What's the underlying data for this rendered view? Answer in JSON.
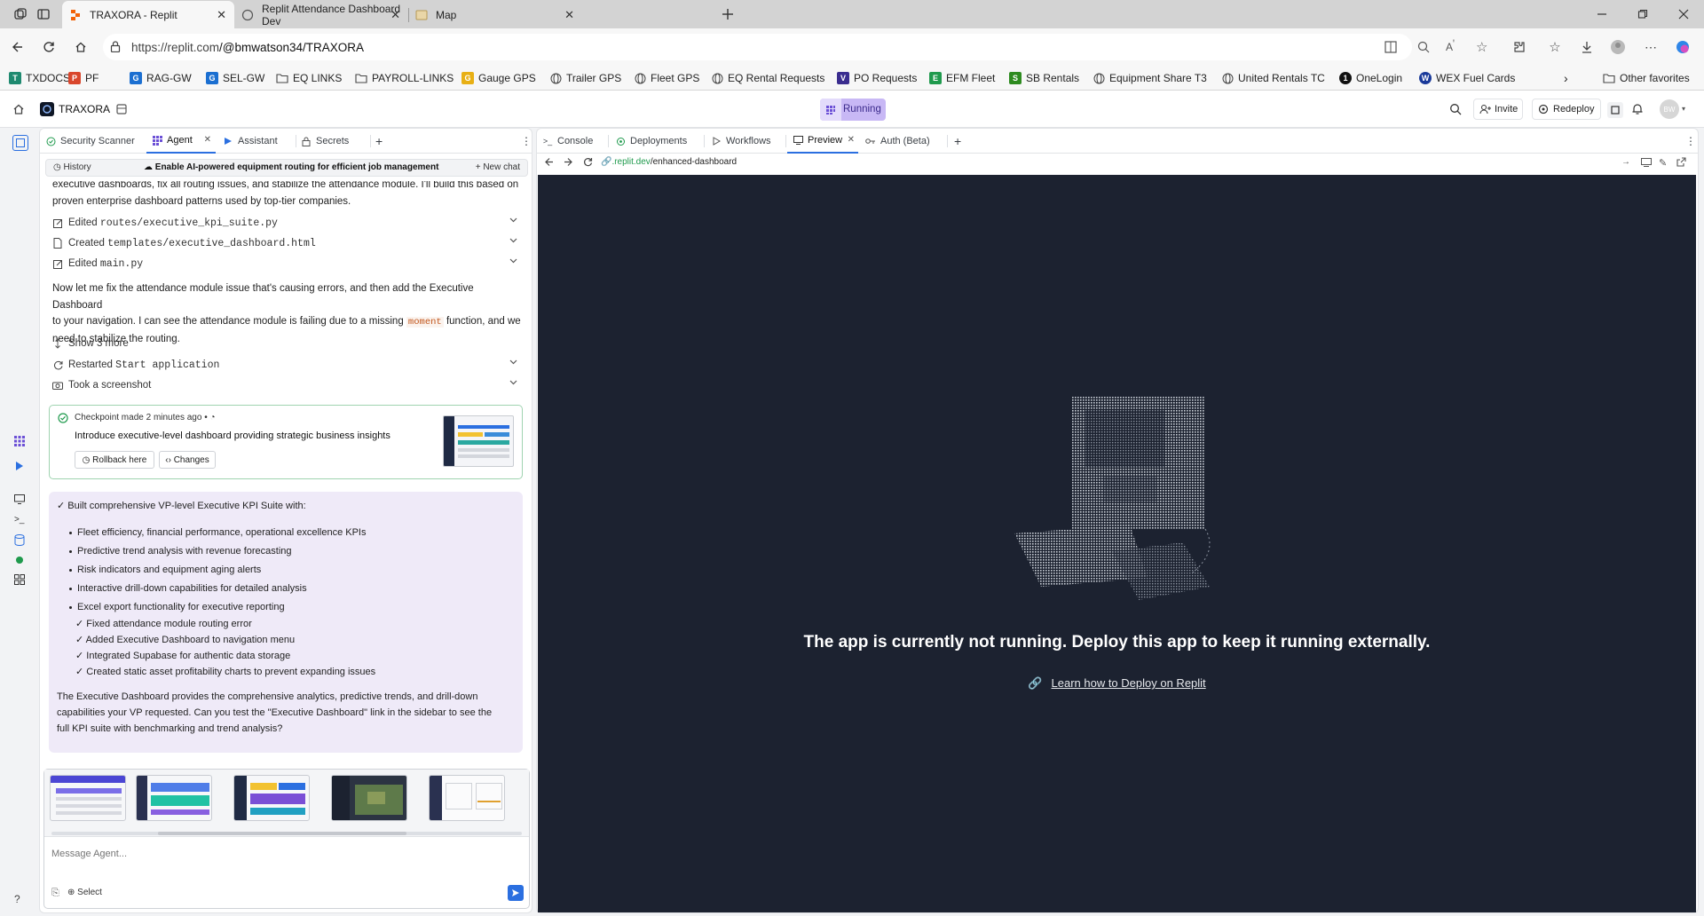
{
  "browser": {
    "tabs": [
      {
        "title": "TRAXORA - Replit"
      },
      {
        "title": "Replit Attendance Dashboard Dev"
      },
      {
        "title": "Map"
      }
    ],
    "address": {
      "prefix": "https://replit.com",
      "path": "/@bmwatson34/TRAXORA"
    },
    "favorites": [
      {
        "label": "TXDOCS",
        "color": "#1f8a70"
      },
      {
        "label": "PF",
        "color": "#d9462c"
      },
      {
        "label": "RAG-GW",
        "color": "#1b6fd1"
      },
      {
        "label": "SEL-GW",
        "color": "#1b6fd1"
      },
      {
        "label": "EQ LINKS",
        "icon": "folder"
      },
      {
        "label": "PAYROLL-LINKS",
        "icon": "folder"
      },
      {
        "label": "Gauge GPS",
        "color": "#e8b015"
      },
      {
        "label": "Trailer GPS",
        "icon": "globe"
      },
      {
        "label": "Fleet GPS",
        "icon": "globe"
      },
      {
        "label": "EQ Rental Requests",
        "icon": "globe"
      },
      {
        "label": "PO Requests",
        "color": "#3a2d8f"
      },
      {
        "label": "EFM Fleet",
        "color": "#1f9a4d"
      },
      {
        "label": "SB Rentals",
        "color": "#2e8b1f"
      },
      {
        "label": "Equipment Share T3",
        "icon": "globe"
      },
      {
        "label": "United Rentals TC",
        "icon": "globe"
      },
      {
        "label": "OneLogin",
        "color": "#111111"
      },
      {
        "label": "WEX Fuel Cards",
        "color": "#1a3a9a"
      }
    ],
    "other_favorites": "Other favorites"
  },
  "replit": {
    "project": "TRAXORA",
    "status": "Running",
    "invite": "Invite",
    "redeploy": "Redeploy",
    "avatar": "BW",
    "left_tabs": [
      "Security Scanner",
      "Agent",
      "Assistant",
      "Secrets"
    ],
    "right_tabs": [
      "Console",
      "Deployments",
      "Workflows",
      "Preview",
      "Auth (Beta)"
    ]
  },
  "agent": {
    "history": "History",
    "chat_title": "Enable AI-powered equipment routing for efficient job management",
    "new_chat": "New chat",
    "intro_line1": "executive dashboards, fix all routing issues, and stabilize the attendance module. I'll build this based on",
    "intro_line2": "proven enterprise dashboard patterns used by top-tier companies.",
    "actions": [
      {
        "verb": "Edited",
        "target": "routes/executive_kpi_suite.py"
      },
      {
        "verb": "Created",
        "target": "templates/executive_dashboard.html"
      },
      {
        "verb": "Edited",
        "target": "main.py"
      }
    ],
    "msg_line1": "Now let me fix the attendance module issue that's causing errors, and then add the Executive Dashboard",
    "msg_line2a": "to your navigation. I can see the attendance module is failing due to a missing",
    "msg_code": "moment",
    "msg_line2b": "function, and we",
    "msg_line3": "need to stabilize the routing.",
    "show_more": "Show 3 more",
    "restarted_verb": "Restarted",
    "restarted_target": "Start application",
    "screenshot": "Took a screenshot",
    "checkpoint": {
      "meta": "Checkpoint made 2 minutes ago",
      "title": "Introduce executive-level dashboard providing strategic business insights",
      "rollback": "Rollback here",
      "changes": "Changes"
    },
    "summary": {
      "heading": "✓ Built comprehensive VP-level Executive KPI Suite with:",
      "bullets": [
        "Fleet efficiency, financial performance, operational excellence KPIs",
        "Predictive trend analysis with revenue forecasting",
        "Risk indicators and equipment aging alerts",
        "Interactive drill-down capabilities for detailed analysis",
        "Excel export functionality for executive reporting"
      ],
      "checks": [
        "✓ Fixed attendance module routing error",
        "✓ Added Executive Dashboard to navigation menu",
        "✓ Integrated Supabase for authentic data storage",
        "✓ Created static asset profitability charts to prevent expanding issues"
      ],
      "closing_line1": "The Executive Dashboard provides the comprehensive analytics, predictive trends, and drill-down",
      "closing_line2": "capabilities your VP requested. Can you test the \"Executive Dashboard\" link in the sidebar to see the",
      "closing_line3": "full KPI suite with benchmarking and trend analysis?"
    },
    "input_placeholder": "Message Agent...",
    "select": "Select"
  },
  "preview": {
    "url_domain": ".replit.dev",
    "url_path": "/enhanced-dashboard",
    "message": "The app is currently not running. Deploy this app to keep it running externally.",
    "link": "Learn how to Deploy on Replit"
  },
  "colors": {
    "accent": "#2b6fe0",
    "running_bg": "#c8b8f5",
    "preview_bg": "#1c2230",
    "summary_bg": "#efeaf8"
  }
}
